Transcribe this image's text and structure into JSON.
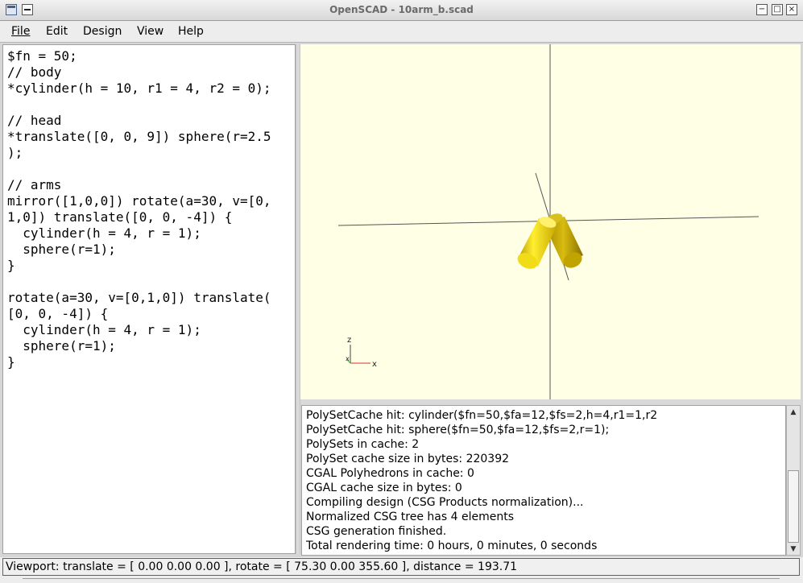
{
  "window": {
    "title": "OpenSCAD - 10arm_b.scad",
    "icon": "app-window-icon",
    "controls": {
      "minimize": "−",
      "maximize": "□",
      "close": "×"
    }
  },
  "menu": {
    "file": "File",
    "edit": "Edit",
    "design": "Design",
    "view": "View",
    "help": "Help"
  },
  "editor": {
    "code": "$fn = 50;\n// body\n*cylinder(h = 10, r1 = 4, r2 = 0);\n\n// head\n*translate([0, 0, 9]) sphere(r=2.5\n);\n\n// arms\nmirror([1,0,0]) rotate(a=30, v=[0,\n1,0]) translate([0, 0, -4]) {\n  cylinder(h = 4, r = 1);\n  sphere(r=1);\n}\n\nrotate(a=30, v=[0,1,0]) translate(\n[0, 0, -4]) {\n  cylinder(h = 4, r = 1);\n  sphere(r=1);\n}"
  },
  "viewport": {
    "background": "#ffffe5",
    "model_color": "#f0e020",
    "axis_labels": {
      "z": "z",
      "x": "x"
    }
  },
  "console": {
    "lines": [
      "PolySetCache hit: cylinder($fn=50,$fa=12,$fs=2,h=4,r1=1,r2",
      "PolySetCache hit: sphere($fn=50,$fa=12,$fs=2,r=1);",
      "PolySets in cache: 2",
      "PolySet cache size in bytes: 220392",
      "CGAL Polyhedrons in cache: 0",
      "CGAL cache size in bytes: 0",
      "Compiling design (CSG Products normalization)...",
      "Normalized CSG tree has 4 elements",
      "CSG generation finished.",
      "Total rendering time: 0 hours, 0 minutes, 0 seconds"
    ]
  },
  "status": {
    "text": "Viewport: translate = [ 0.00 0.00 0.00 ], rotate = [ 75.30 0.00 355.60 ], distance = 193.71"
  }
}
